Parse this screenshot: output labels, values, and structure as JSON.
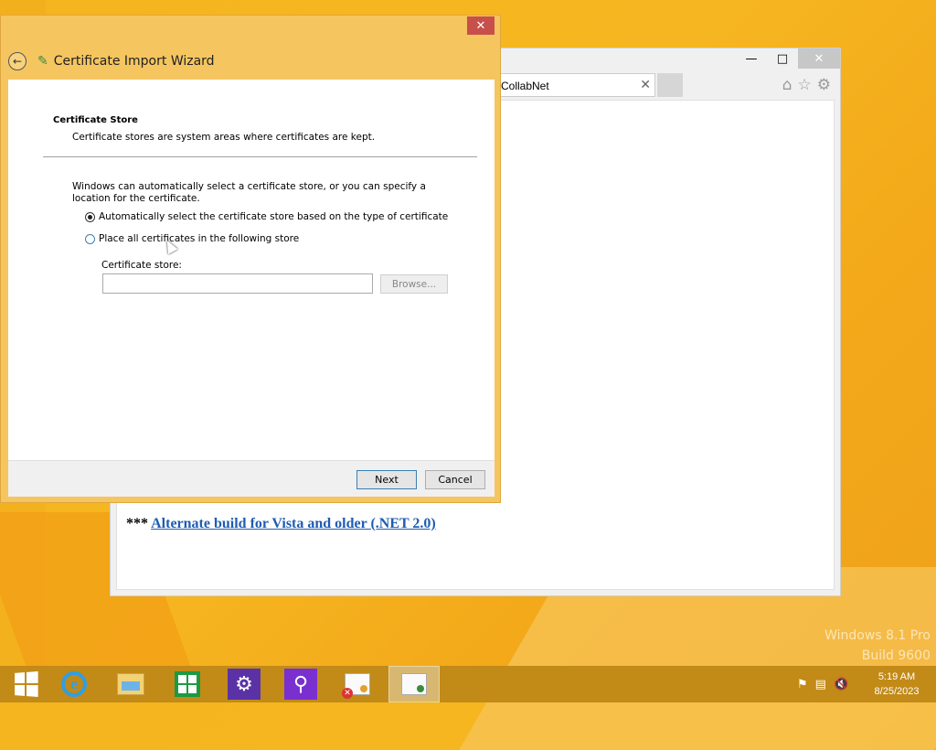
{
  "browser": {
    "tab_title": "CollabNet",
    "tab_close": "✕",
    "min_glyph": "—",
    "max_glyph": "□",
    "close_glyph": "✕",
    "icons": [
      "home-icon",
      "star-icon",
      "gear-icon"
    ],
    "alt_build_prefix": "*** ",
    "alt_build_link": "Alternate build for Vista and older (.NET 2.0)"
  },
  "wizard": {
    "title": "Certificate Import Wizard",
    "close_glyph": "✕",
    "back_glyph": "←",
    "section_title": "Certificate Store",
    "section_desc": "Certificate stores are system areas where certificates are kept.",
    "explain": "Windows can automatically select a certificate store, or you can specify a location for the certificate.",
    "option_auto": "Automatically select the certificate store based on the type of certificate",
    "option_manual": "Place all certificates in the following store",
    "store_label": "Certificate store:",
    "store_value": "",
    "browse_label": "Browse...",
    "next_label": "Next",
    "cancel_label": "Cancel",
    "selected_option": "auto"
  },
  "watermark": {
    "line1": "Windows 8.1 Pro",
    "line2": "Build 9600"
  },
  "taskbar": {
    "items": [
      "start-button",
      "internet-explorer",
      "file-explorer",
      "windows-store",
      "settings",
      "search-app",
      "certificate-manager",
      "certificate-import-wizard"
    ],
    "time": "5:19 AM",
    "date": "8/25/2023"
  },
  "colors": {
    "desktop": "#f4b51e",
    "wizard_frame": "#f5c560",
    "taskbar": "#c28a17",
    "link": "#1e5cb3"
  }
}
